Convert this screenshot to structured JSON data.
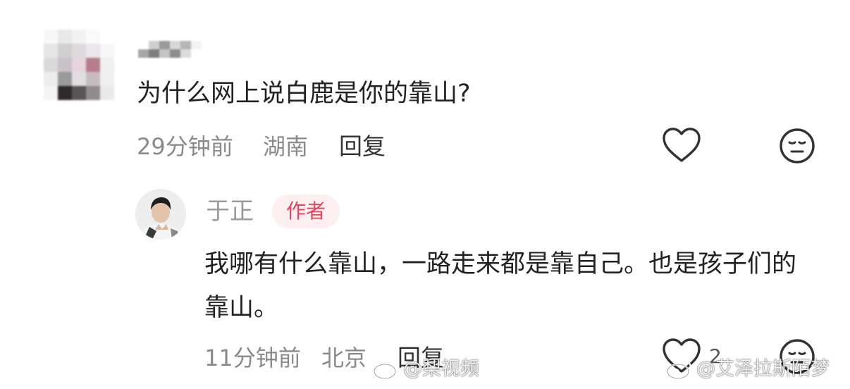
{
  "comment": {
    "text": "为什么网上说白鹿是你的靠山?",
    "time": "29分钟前",
    "location": "湖南",
    "reply_label": "回复",
    "like_icon": "heart-outline-icon",
    "dislike_icon": "meh-face-icon"
  },
  "reply": {
    "username": "于正",
    "badge": "作者",
    "text": "我哪有什么靠山，一路走来都是靠自己。也是孩子们的靠山。",
    "time": "11分钟前",
    "location": "北京",
    "reply_label": "回复",
    "like_count": "2",
    "like_icon": "heart-outline-icon",
    "dislike_icon": "meh-face-icon"
  },
  "watermarks": [
    {
      "text": "@梨视频",
      "icon": "weibo-icon"
    },
    {
      "text": "@艾泽拉斯陌梦",
      "icon": "weibo-icon"
    }
  ],
  "colors": {
    "text_primary": "#222222",
    "text_meta": "#8a8a8a",
    "badge_text": "#e0455e",
    "badge_bg": "#fdeef0"
  }
}
